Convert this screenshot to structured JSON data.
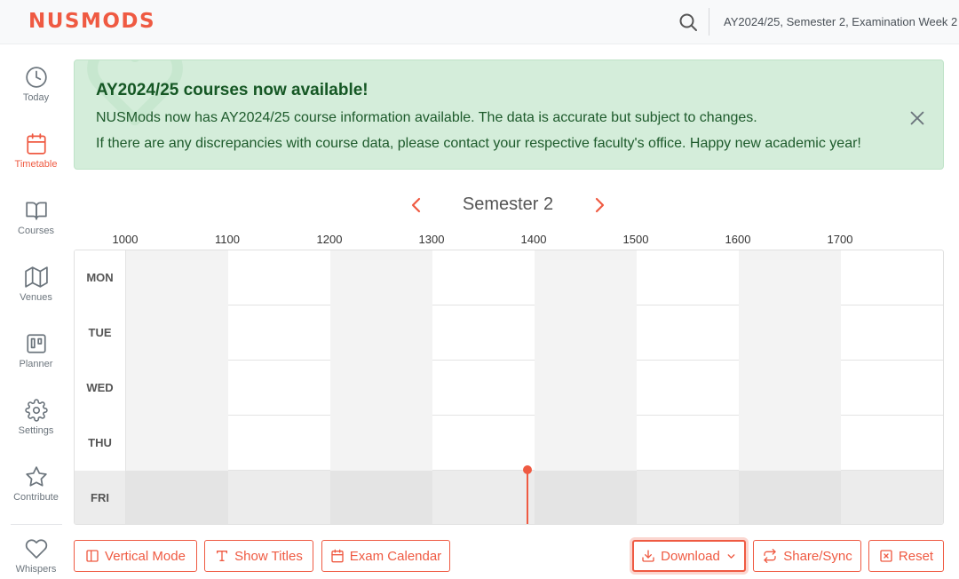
{
  "header": {
    "logo": "NUSMODS",
    "week_info": "AY2024/25, Semester 2, Examination Week 2"
  },
  "sidebar": {
    "items": [
      {
        "label": "Today",
        "icon": "clock-icon"
      },
      {
        "label": "Timetable",
        "icon": "calendar-icon",
        "active": true
      },
      {
        "label": "Courses",
        "icon": "book-icon"
      },
      {
        "label": "Venues",
        "icon": "map-icon"
      },
      {
        "label": "Planner",
        "icon": "planner-icon"
      },
      {
        "label": "Settings",
        "icon": "gear-icon"
      },
      {
        "label": "Contribute",
        "icon": "star-icon"
      },
      {
        "label": "Whispers",
        "icon": "heart-icon"
      }
    ]
  },
  "alert": {
    "title": "AY2024/25 courses now available!",
    "line1": "NUSMods now has AY2024/25 course information available. The data is accurate but subject to changes.",
    "line2": "If there are any discrepancies with course data, please contact your respective faculty's office. Happy new academic year!"
  },
  "timetable": {
    "semester_label": "Semester 2",
    "hours": [
      "1000",
      "1100",
      "1200",
      "1300",
      "1400",
      "1500",
      "1600",
      "1700"
    ],
    "days": [
      "MON",
      "TUE",
      "WED",
      "THU",
      "FRI"
    ],
    "today": "FRI"
  },
  "actions": {
    "vertical_mode": "Vertical Mode",
    "show_titles": "Show Titles",
    "exam_calendar": "Exam Calendar",
    "download": "Download",
    "share_sync": "Share/Sync",
    "reset": "Reset"
  },
  "colors": {
    "brand": "#ef5a42",
    "alert_bg": "#d4edda",
    "alert_text": "#155724"
  }
}
